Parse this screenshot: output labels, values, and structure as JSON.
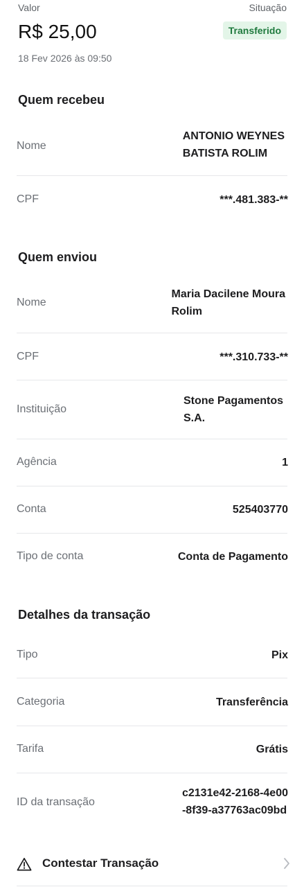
{
  "header": {
    "valor_label": "Valor",
    "situacao_label": "Situação",
    "amount": "R$ 25,00",
    "status": "Transferido",
    "datetime": "18 Fev 2026 às 09:50"
  },
  "recebeu": {
    "title": "Quem recebeu",
    "rows": [
      {
        "label": "Nome",
        "value_line1": "ANTONIO WEYNES",
        "value_line2": "BATISTA ROLIM"
      },
      {
        "label": "CPF",
        "value": "***.481.383-**"
      }
    ]
  },
  "enviou": {
    "title": "Quem enviou",
    "rows": [
      {
        "label": "Nome",
        "value_line1": "Maria Dacilene Moura",
        "value_line2": "Rolim"
      },
      {
        "label": "CPF",
        "value": "***.310.733-**"
      },
      {
        "label": "Instituição",
        "value_line1": "Stone Pagamentos",
        "value_line2": "S.A."
      },
      {
        "label": "Agência",
        "value": "1"
      },
      {
        "label": "Conta",
        "value": "525403770"
      },
      {
        "label": "Tipo de conta",
        "value": "Conta de Pagamento"
      }
    ]
  },
  "detalhes": {
    "title": "Detalhes da transação",
    "rows": [
      {
        "label": "Tipo",
        "value": "Pix"
      },
      {
        "label": "Categoria",
        "value": "Transferência"
      },
      {
        "label": "Tarifa",
        "value": "Grátis"
      },
      {
        "label": "ID da transação",
        "value_line1": "c2131e42-2168-4e00",
        "value_line2": "-8f39-a37763ac09bd"
      }
    ]
  },
  "actions": {
    "contest_label": "Contestar Transação",
    "contest_icon": "warning-triangle-icon",
    "chevron_icon": "chevron-right-icon"
  },
  "colors": {
    "status_bg": "#e3f5e8",
    "status_text": "#1f7a3e",
    "label_text": "#6b6f75",
    "divider": "#e6e7ea"
  }
}
